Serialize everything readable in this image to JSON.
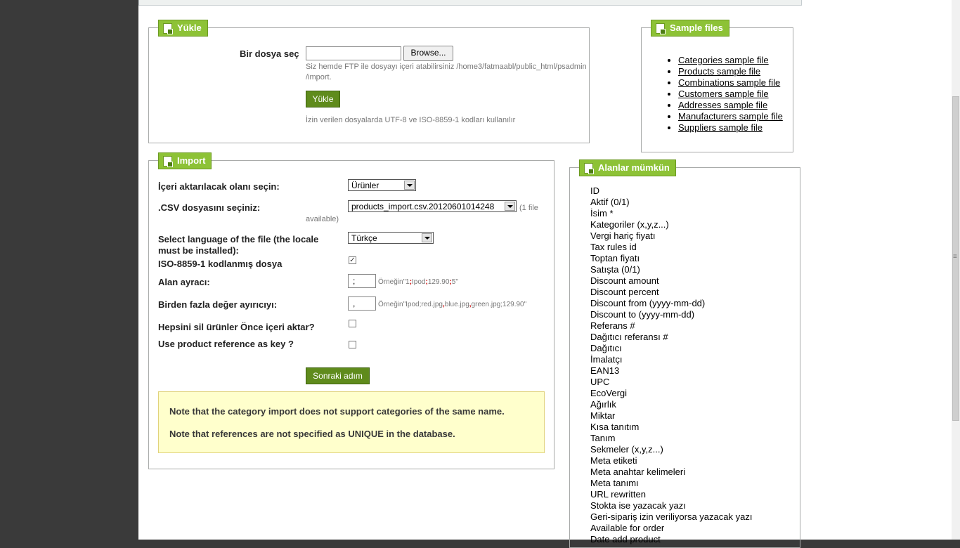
{
  "upload": {
    "legend": "Yükle",
    "choose_label": "Bir dosya seç",
    "browse_label": "Browse...",
    "ftp_hint_line1": "Siz hemde FTP ile dosyayı içeri atabilirsiniz /home3/fatmaabl/public_html/psadmin",
    "ftp_hint_line2": "/import.",
    "button_label": "Yükle",
    "encoding_hint": "İzin verilen dosyalarda UTF-8 ve ISO-8859-1 kodları kullanılır"
  },
  "samples": {
    "legend": "Sample files",
    "items": [
      "Categories sample file",
      "Products sample file",
      "Combinations sample file",
      "Customers sample file",
      "Addresses sample file",
      "Manufacturers sample file",
      "Suppliers sample file"
    ]
  },
  "import": {
    "legend": "Import",
    "entity_label": "İçeri aktarılacak olanı seçin:",
    "entity_value": "Ürünler",
    "csv_label": ".CSV dosyasını seçiniz:",
    "csv_value": "products_import.csv.20120601014248",
    "csv_count_part1": "(1 file",
    "csv_count_part2": "available)",
    "lang_label_line1": "Select language of the file (the locale",
    "lang_label_line2": "must be installed):",
    "lang_value": "Türkçe",
    "iso_label": "ISO-8859-1 kodlanmış dosya",
    "iso_checked": "✓",
    "sep_label": "Alan ayracı:",
    "sep_value": ";",
    "sep_example_prefix": "Örneğin\"1",
    "sep_example_s1": ";",
    "sep_example_m1": "Ipod",
    "sep_example_s2": ";",
    "sep_example_m2": "129.90",
    "sep_example_s3": ";",
    "sep_example_m3": "5",
    "sep_example_suffix": "\"",
    "multi_label": "Birden fazla değer ayırıcıyı:",
    "multi_value": ",",
    "multi_example_prefix": "Örneğin\"Ipod;red.jpg",
    "multi_example_s1": ",",
    "multi_example_m1": "blue.jpg",
    "multi_example_s2": ",",
    "multi_example_suffix": "green.jpg;129.90\"",
    "delete_label": "Hepsini sil ürünler Önce içeri aktar?",
    "reference_label": "Use product reference as key ?",
    "next_button": "Sonraki adım",
    "note1": "Note that the category import does not support categories of the same name.",
    "note2": "Note that references are not specified as UNIQUE in the database."
  },
  "fields": {
    "legend": "Alanlar mümkün",
    "items": [
      "ID",
      "Aktif (0/1)",
      "İsim *",
      "Kategoriler (x,y,z...)",
      "Vergi hariç fiyatı",
      "Tax rules id",
      "Toptan fiyatı",
      "Satışta (0/1)",
      "Discount amount",
      "Discount percent",
      "Discount from (yyyy-mm-dd)",
      "Discount to (yyyy-mm-dd)",
      "Referans #",
      "Dağıtıcı referansı #",
      "Dağıtıcı",
      "İmalatçı",
      "EAN13",
      "UPC",
      "EcoVergi",
      "Ağırlık",
      "Miktar",
      "Kısa tanıtım",
      "Tanım",
      "Sekmeler (x,y,z...)",
      "Meta etiketi",
      "Meta anahtar kelimeleri",
      "Meta tanımı",
      "URL rewritten",
      "Stokta ise yazacak yazı",
      "Geri-sipariş izin veriliyorsa yazacak yazı",
      "Available for order",
      "Date add product"
    ]
  },
  "colors": {
    "legend_green": "#8dc236",
    "button_green": "#5f8b1c",
    "note_bg": "#ffffcc",
    "separator_red": "#cc0000"
  }
}
